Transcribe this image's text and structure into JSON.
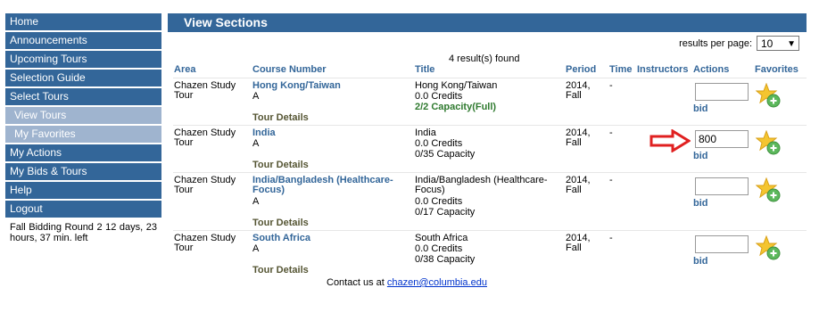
{
  "sidebar": {
    "items": [
      {
        "label": "Home"
      },
      {
        "label": "Announcements"
      },
      {
        "label": "Upcoming Tours"
      },
      {
        "label": "Selection Guide"
      },
      {
        "label": "Select Tours"
      },
      {
        "label": "View Tours"
      },
      {
        "label": "My Favorites"
      },
      {
        "label": "My Actions"
      },
      {
        "label": "My Bids & Tours"
      },
      {
        "label": "Help"
      },
      {
        "label": "Logout"
      }
    ],
    "status": "Fall Bidding Round 2 12 days, 23 hours, 37 min. left"
  },
  "header": {
    "title": "View Sections"
  },
  "per_page": {
    "label": "results per page:",
    "value": "10"
  },
  "results": {
    "count_text": "4 result(s) found"
  },
  "table": {
    "columns": [
      "Area",
      "Course Number",
      "Title",
      "Period",
      "Time",
      "Instructors",
      "Actions",
      "Favorites"
    ],
    "rows": [
      {
        "area": "Chazen Study Tour",
        "course": "Hong Kong/Taiwan",
        "section": "A",
        "details": "Tour Details",
        "title": "Hong Kong/Taiwan",
        "credits": "0.0 Credits",
        "capacity": "2/2 Capacity(Full)",
        "period": "2014, Fall",
        "time": "-",
        "bid_value": "",
        "bid_label": "bid"
      },
      {
        "area": "Chazen Study Tour",
        "course": "India",
        "section": "A",
        "details": "Tour Details",
        "title": "India",
        "credits": "0.0 Credits",
        "capacity": "0/35 Capacity",
        "period": "2014, Fall",
        "time": "-",
        "bid_value": "800",
        "bid_label": "bid"
      },
      {
        "area": "Chazen Study Tour",
        "course": "India/Bangladesh (Healthcare-Focus)",
        "section": "A",
        "details": "Tour Details",
        "title": "India/Bangladesh (Healthcare-Focus)",
        "credits": "0.0 Credits",
        "capacity": "0/17 Capacity",
        "period": "2014, Fall",
        "time": "-",
        "bid_value": "",
        "bid_label": "bid"
      },
      {
        "area": "Chazen Study Tour",
        "course": "South Africa",
        "section": "A",
        "details": "Tour Details",
        "title": "South Africa",
        "credits": "0.0 Credits",
        "capacity": "0/38 Capacity",
        "period": "2014, Fall",
        "time": "-",
        "bid_value": "",
        "bid_label": "bid"
      }
    ]
  },
  "footer": {
    "text": "Contact us at",
    "email": "chazen@columbia.edu"
  },
  "colors": {
    "nav": "#336699",
    "nav_sub": "#9fb4cf",
    "link": "#336699",
    "arrow": "#e02020",
    "full": "#2f7a2f"
  }
}
